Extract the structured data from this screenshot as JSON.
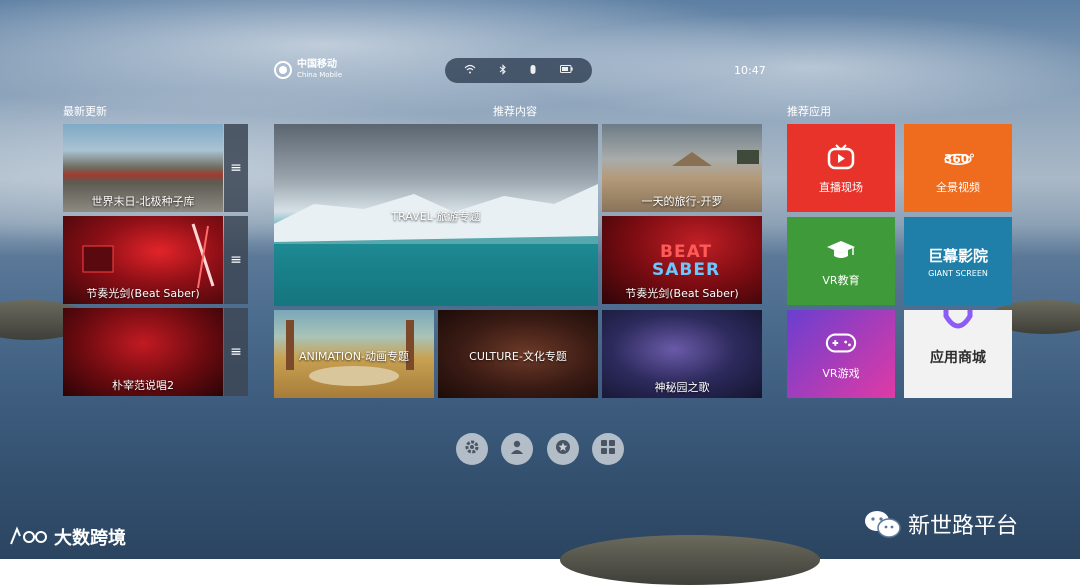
{
  "header": {
    "logo_cn": "中国移动",
    "logo_en": "China Mobile",
    "status_icons": [
      "wifi-icon",
      "bluetooth-icon",
      "controller-icon",
      "battery-icon"
    ],
    "time": "10:47"
  },
  "sections": {
    "latest": "最新更新",
    "recommended": "推荐内容",
    "apps": "推荐应用"
  },
  "latest": [
    {
      "label": "世界末日-北极种子库"
    },
    {
      "label": "节奏光剑(Beat Saber)"
    },
    {
      "label": "朴宰范说唱2"
    }
  ],
  "recommended": {
    "hero": "TRAVEL-旅游专题",
    "cairo": "一天的旅行-开罗",
    "beat_saber": "节奏光剑(Beat Saber)",
    "beat_logo_1": "BEAT",
    "beat_logo_2": "SABER",
    "animation": "ANIMATION-动画专题",
    "culture": "CULTURE-文化专题",
    "secret_garden": "神秘园之歌"
  },
  "apps": {
    "live": "直播现场",
    "panorama": "全景视频",
    "panorama_badge": "360°",
    "vr_edu": "VR教育",
    "giant_cn": "巨幕影院",
    "giant_en": "GIANT SCREEN",
    "vr_game": "VR游戏",
    "store": "应用商城"
  },
  "colors": {
    "live": "#e8332a",
    "panorama": "#ef6b1d",
    "vr_edu": "#3f9b3a",
    "giant": "#1f7fa8",
    "vr_game_from": "#6a3fd0",
    "vr_game_to": "#e03aa5",
    "store": "#f2f2f2"
  },
  "dock": [
    "settings-icon",
    "user-icon",
    "star-icon",
    "grid-icon"
  ],
  "watermarks": {
    "left": "大数跨境",
    "right": "新世路平台"
  }
}
